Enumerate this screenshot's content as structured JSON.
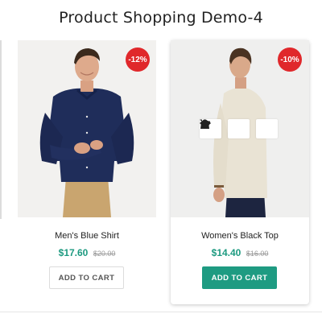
{
  "page": {
    "title": "Product Shopping Demo-4"
  },
  "products": [
    {
      "name": "Men's Blue Shirt",
      "price": "$17.60",
      "old_price": "$20.00",
      "discount": "-12%",
      "button": "ADD TO CART",
      "image_icon": "man-blue-shirt-photo"
    },
    {
      "name": "Women's Black Top",
      "price": "$14.40",
      "old_price": "$16.00",
      "discount": "-10%",
      "button": "ADD TO CART",
      "image_icon": "man-beige-shirt-photo",
      "actions": [
        "eye-icon",
        "bag-icon",
        "cart-icon"
      ]
    }
  ],
  "colors": {
    "accent": "#1e9b82",
    "price": "#1d9a80",
    "badge": "#e0282b"
  }
}
